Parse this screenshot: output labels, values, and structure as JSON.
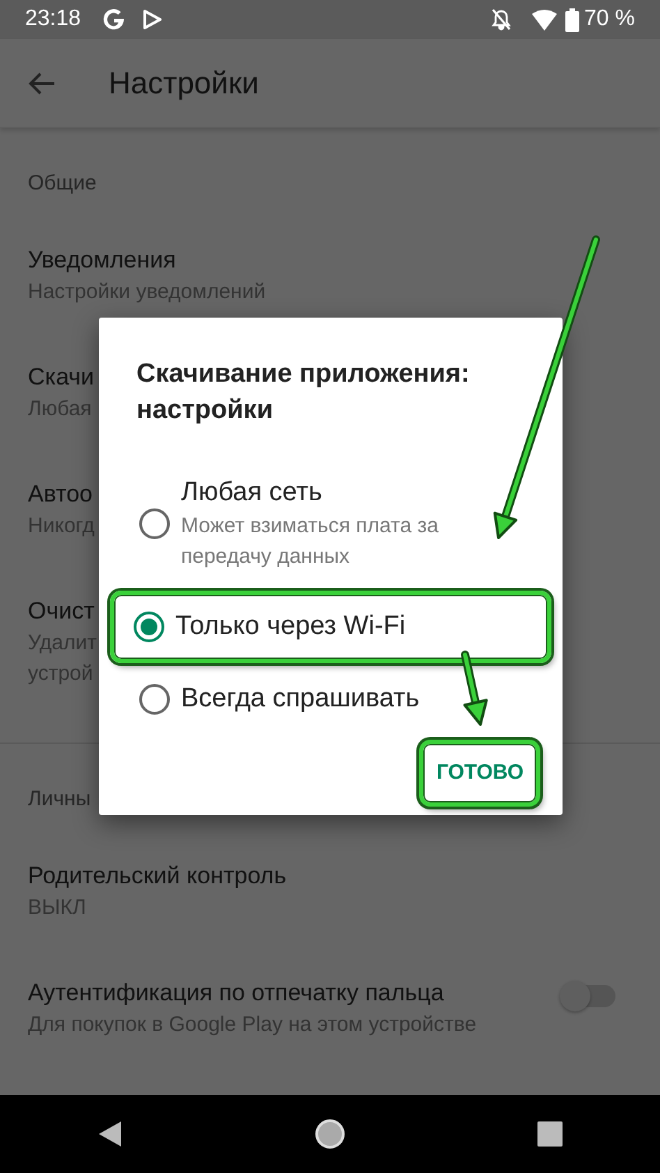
{
  "status_bar": {
    "time": "23:18",
    "battery": "70 %"
  },
  "app_bar": {
    "title": "Настройки"
  },
  "sections": [
    {
      "header": "Общие",
      "items": [
        {
          "title": "Уведомления",
          "subtitle": [
            "Настройки уведомлений"
          ]
        },
        {
          "title": "Скачи",
          "subtitle": [
            "Любая"
          ]
        },
        {
          "title": "Автоо",
          "subtitle": [
            "Никогд"
          ]
        },
        {
          "title": "Очист",
          "subtitle": [
            "Удалит",
            "устрой"
          ]
        }
      ]
    },
    {
      "header": "Личны",
      "items": [
        {
          "title": "Родительский контроль",
          "subtitle": [
            "ВЫКЛ"
          ]
        },
        {
          "title": "Аутентификация по отпечатку пальца",
          "subtitle": [
            "Для покупок в Google Play на этом устройстве"
          ],
          "kind": "switch",
          "on": false
        }
      ]
    }
  ],
  "dialog": {
    "title": "Скачивание приложения: настройки",
    "options": [
      {
        "label": "Любая сеть",
        "description": "Может взиматься плата за передачу данных",
        "selected": false,
        "highlighted": false
      },
      {
        "label": "Только через Wi-Fi",
        "selected": true,
        "highlighted": true
      },
      {
        "label": "Всегда спрашивать",
        "selected": false,
        "highlighted": false
      }
    ],
    "button": {
      "label": "ГОТОВО",
      "highlighted": true
    }
  }
}
